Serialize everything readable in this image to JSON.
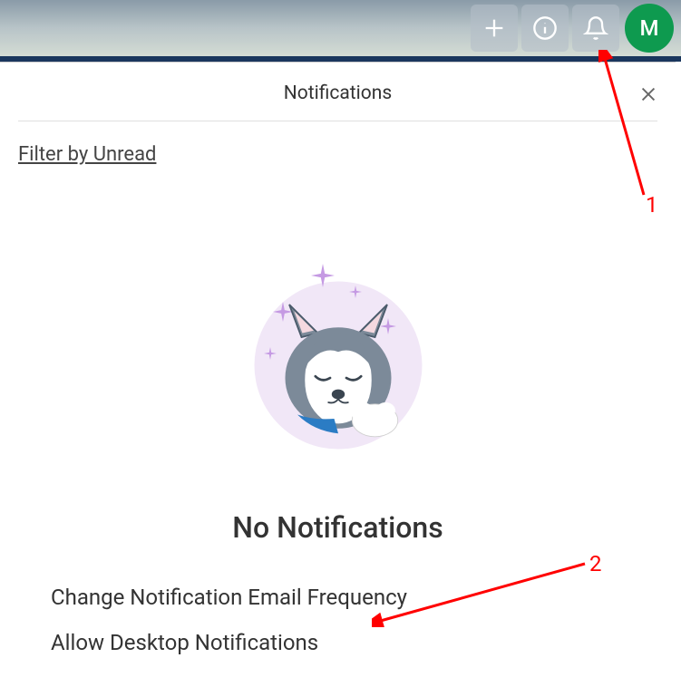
{
  "topbar": {
    "avatar_initial": "M"
  },
  "panel": {
    "title": "Notifications",
    "filter_label": "Filter by Unread"
  },
  "empty_state": {
    "heading": "No Notifications",
    "action_email": "Change Notification Email Frequency",
    "action_desktop": "Allow Desktop Notifications"
  },
  "annotations": {
    "label1": "1",
    "label2": "2"
  }
}
